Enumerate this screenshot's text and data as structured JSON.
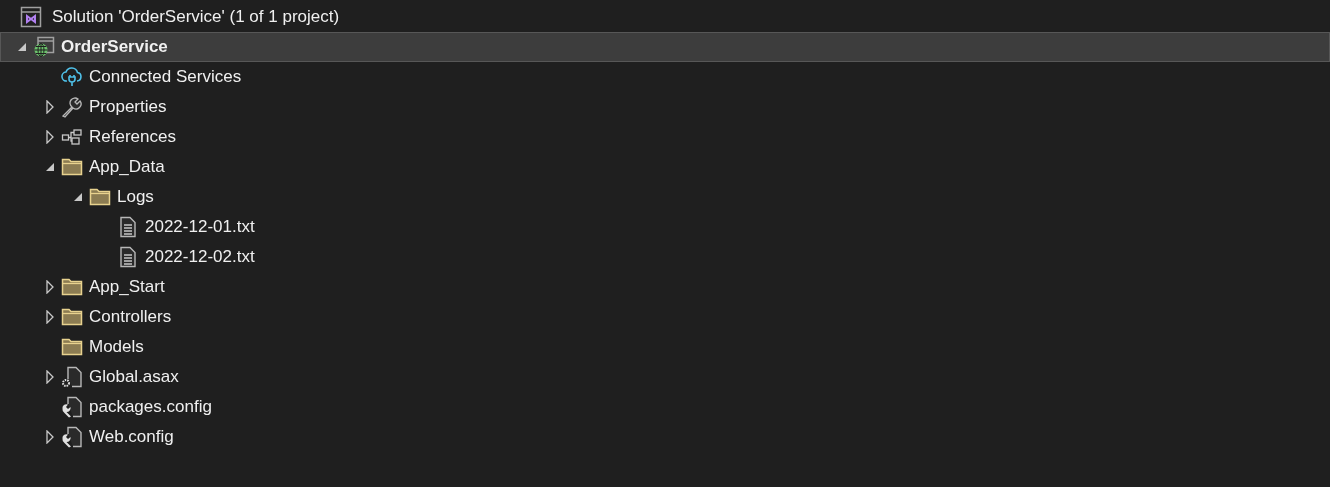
{
  "solution": {
    "label": "Solution 'OrderService' (1 of 1 project)",
    "kind": "solution"
  },
  "tree": [
    {
      "label": "OrderService",
      "kind": "web-project",
      "expanded": true,
      "selected": true,
      "bold": true,
      "children": [
        {
          "label": "Connected Services",
          "kind": "connected-services",
          "selected": false
        },
        {
          "label": "Properties",
          "kind": "properties",
          "expanded": false,
          "selected": false
        },
        {
          "label": "References",
          "kind": "references",
          "expanded": false,
          "selected": false
        },
        {
          "label": "App_Data",
          "kind": "folder",
          "expanded": true,
          "selected": false,
          "children": [
            {
              "label": "Logs",
              "kind": "folder",
              "expanded": true,
              "selected": false,
              "children": [
                {
                  "label": "2022-12-01.txt",
                  "kind": "text-file",
                  "selected": false
                },
                {
                  "label": "2022-12-02.txt",
                  "kind": "text-file",
                  "selected": false
                }
              ]
            }
          ]
        },
        {
          "label": "App_Start",
          "kind": "folder",
          "expanded": false,
          "selected": false
        },
        {
          "label": "Controllers",
          "kind": "folder",
          "expanded": false,
          "selected": false
        },
        {
          "label": "Models",
          "kind": "folder",
          "selected": false
        },
        {
          "label": "Global.asax",
          "kind": "asax-file",
          "expanded": false,
          "selected": false
        },
        {
          "label": "packages.config",
          "kind": "config-file",
          "selected": false
        },
        {
          "label": "Web.config",
          "kind": "config-file",
          "expanded": false,
          "selected": false
        }
      ]
    }
  ]
}
